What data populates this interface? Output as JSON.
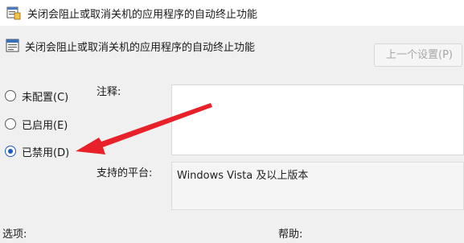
{
  "window": {
    "title": "关闭会阻止或取消关机的应用程序的自动终止功能",
    "icon": "policy-setting-icon"
  },
  "policy": {
    "header_title": "关闭会阻止或取消关机的应用程序的自动终止功能",
    "header_icon": "policy-document-icon"
  },
  "toolbar": {
    "prev_setting_label": "上一个设置(P)"
  },
  "state_options": [
    {
      "label": "未配置(C)",
      "checked": false
    },
    {
      "label": "已启用(E)",
      "checked": false
    },
    {
      "label": "已禁用(D)",
      "checked": true
    }
  ],
  "comment": {
    "label": "注释:",
    "value": ""
  },
  "supported_platform": {
    "label": "支持的平台:",
    "value": "Windows Vista 及以上版本"
  },
  "options_label": "选项:",
  "help_label": "帮助:",
  "colors": {
    "annotation_arrow": "#e8202a",
    "radio_selected": "#1f5bb8"
  }
}
